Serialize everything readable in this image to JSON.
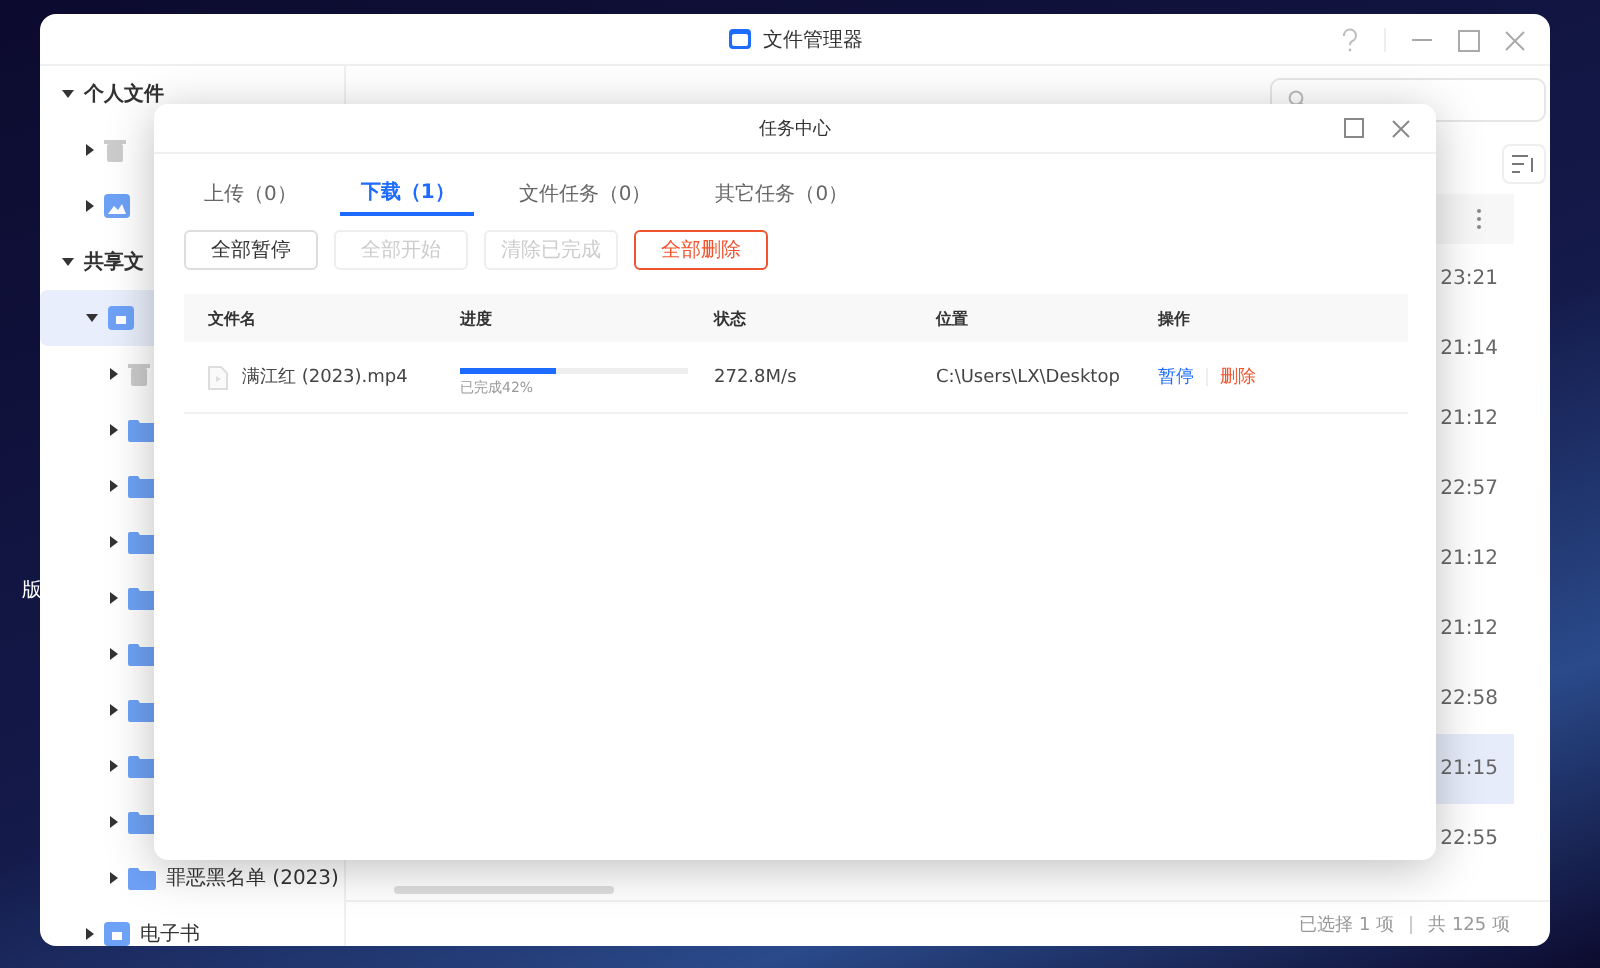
{
  "desktop": {
    "label": "版"
  },
  "window": {
    "title": "文件管理器",
    "sidebar": [
      {
        "kind": "group",
        "label": "个人文件",
        "expanded": true,
        "children": [
          {
            "kind": "trash",
            "selected": false
          },
          {
            "kind": "photo",
            "selected": false
          }
        ]
      },
      {
        "kind": "group",
        "label": "共享文",
        "expanded": true,
        "children": [
          {
            "kind": "share",
            "selected": true,
            "children": [
              {
                "kind": "trash"
              },
              {
                "kind": "folder"
              },
              {
                "kind": "folder"
              },
              {
                "kind": "folder"
              },
              {
                "kind": "folder"
              },
              {
                "kind": "folder"
              },
              {
                "kind": "folder"
              },
              {
                "kind": "folder"
              },
              {
                "kind": "folder"
              },
              {
                "kind": "folder",
                "label": "罪恶黑名单 (2023)"
              }
            ]
          },
          {
            "kind": "share",
            "label": "电子书",
            "selected": false
          }
        ]
      }
    ],
    "times": [
      {
        "text": "23:21",
        "selected": false
      },
      {
        "text": "21:14",
        "selected": false
      },
      {
        "text": "21:12",
        "selected": false
      },
      {
        "text": "22:57",
        "selected": false
      },
      {
        "text": "21:12",
        "selected": false
      },
      {
        "text": "21:12",
        "selected": false
      },
      {
        "text": "22:58",
        "selected": false
      },
      {
        "text": "21:15",
        "selected": true
      },
      {
        "text": "22:55",
        "selected": false
      }
    ],
    "status_bar": {
      "selected": "已选择 1 项",
      "total": "共 125 项"
    }
  },
  "dialog": {
    "title": "任务中心",
    "tabs": [
      {
        "label": "上传（0）",
        "selected": false
      },
      {
        "label": "下载（1）",
        "selected": true
      },
      {
        "label": "文件任务（0）",
        "selected": false
      },
      {
        "label": "其它任务（0）",
        "selected": false
      }
    ],
    "buttons": [
      {
        "label": "全部暂停",
        "kind": "normal",
        "disabled": false
      },
      {
        "label": "全部开始",
        "kind": "normal",
        "disabled": true
      },
      {
        "label": "清除已完成",
        "kind": "normal",
        "disabled": true
      },
      {
        "label": "全部删除",
        "kind": "danger",
        "disabled": false
      }
    ],
    "columns": [
      "文件名",
      "进度",
      "状态",
      "位置",
      "操作"
    ],
    "rows": [
      {
        "name": "满江红 (2023).mp4",
        "level": 0.42,
        "progress": "已完成42%",
        "speed": "272.8M/s",
        "location": "C:\\Users\\LX\\Desktop",
        "actions": [
          {
            "label": "暂停",
            "kind": "primary"
          },
          {
            "label": "删除",
            "kind": "danger"
          }
        ]
      }
    ]
  }
}
